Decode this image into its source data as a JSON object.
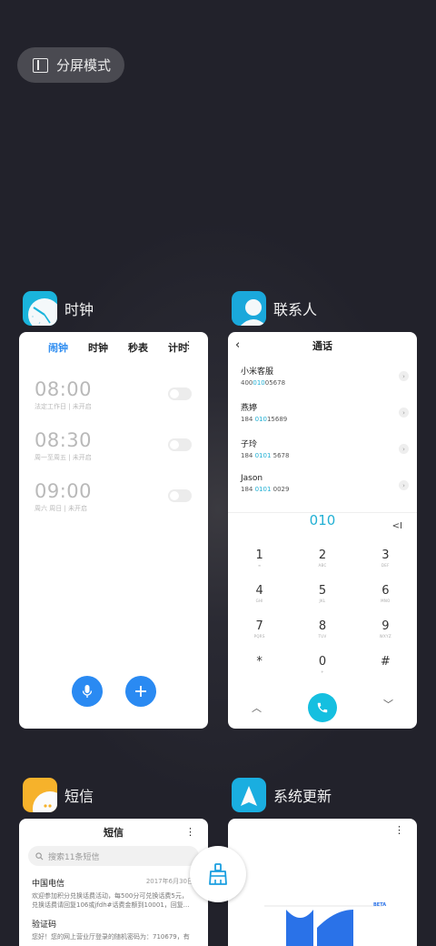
{
  "split_screen": {
    "label": "分屏模式",
    "icon": "split-screen-icon"
  },
  "clock_app": {
    "name": "时钟",
    "tabs": [
      "闹钟",
      "时钟",
      "秒表",
      "计时"
    ],
    "more": "⋮",
    "alarms": [
      {
        "time": "08:00",
        "desc": "法定工作日 | 未开启"
      },
      {
        "time": "08:30",
        "desc": "周一至周五 | 未开启"
      },
      {
        "time": "09:00",
        "desc": "周六 周日 | 未开启"
      }
    ],
    "colors": {
      "accent": "#2d8cf0",
      "fab": "#2a8af2"
    }
  },
  "contacts_app": {
    "name": "联系人",
    "title": "通话",
    "entries": [
      {
        "name": "小米客服",
        "num_pre": "400",
        "num_hl": "010",
        "num_post": "05678"
      },
      {
        "name": "燕婷",
        "num_pre": "184 ",
        "num_hl": "010",
        "num_post": "15689"
      },
      {
        "name": "子玲",
        "num_pre": "184 ",
        "num_hl": "0101",
        "num_post": " 5678"
      },
      {
        "name": "Jason",
        "num_pre": "184 ",
        "num_hl": "0101",
        "num_post": " 0029"
      }
    ],
    "dial_entry": "010",
    "keys": [
      {
        "d": "1",
        "l": "∞"
      },
      {
        "d": "2",
        "l": "ABC"
      },
      {
        "d": "3",
        "l": "DEF"
      },
      {
        "d": "4",
        "l": "GHI"
      },
      {
        "d": "5",
        "l": "JKL"
      },
      {
        "d": "6",
        "l": "MNO"
      },
      {
        "d": "7",
        "l": "PQRS"
      },
      {
        "d": "8",
        "l": "TUV"
      },
      {
        "d": "9",
        "l": "WXYZ"
      },
      {
        "d": "*",
        "l": ""
      },
      {
        "d": "0",
        "l": "+"
      },
      {
        "d": "#",
        "l": ""
      }
    ],
    "colors": {
      "accent": "#15bfe0"
    }
  },
  "sms_app": {
    "name": "短信",
    "title": "短信",
    "search_placeholder": "搜索11条短信",
    "messages": [
      {
        "name": "中国电信",
        "date": "2017年6月30日",
        "line1": "欢迎参加积分兑换话费活动，每500分可兑换话费5元，",
        "line2": "兑换话费请回复106或jfdh#话费金额到10001，回复..."
      },
      {
        "name": "验证码",
        "date": "",
        "line1": "您好！您的网上营业厅登录的随机密码为：710679，有",
        "line2": ""
      }
    ]
  },
  "update_app": {
    "name": "系统更新",
    "badge": "BETA"
  }
}
